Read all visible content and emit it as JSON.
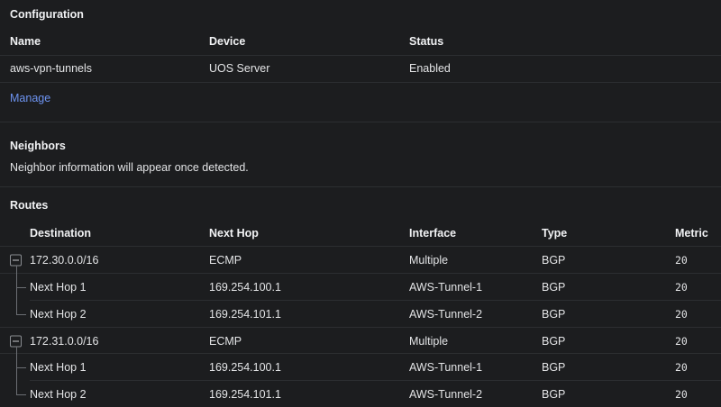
{
  "configuration": {
    "title": "Configuration",
    "headers": {
      "name": "Name",
      "device": "Device",
      "status": "Status"
    },
    "row": {
      "name": "aws-vpn-tunnels",
      "device": "UOS Server",
      "status": "Enabled"
    },
    "manage_link": "Manage"
  },
  "neighbors": {
    "title": "Neighbors",
    "message": "Neighbor information will appear once detected."
  },
  "routes": {
    "title": "Routes",
    "headers": {
      "destination": "Destination",
      "next_hop": "Next Hop",
      "interface": "Interface",
      "type": "Type",
      "metric": "Metric"
    },
    "groups": [
      {
        "destination": "172.30.0.0/16",
        "next_hop": "ECMP",
        "interface": "Multiple",
        "type": "BGP",
        "metric": "20",
        "children": [
          {
            "destination": "Next Hop 1",
            "next_hop": "169.254.100.1",
            "interface": "AWS-Tunnel-1",
            "type": "BGP",
            "metric": "20"
          },
          {
            "destination": "Next Hop 2",
            "next_hop": "169.254.101.1",
            "interface": "AWS-Tunnel-2",
            "type": "BGP",
            "metric": "20"
          }
        ]
      },
      {
        "destination": "172.31.0.0/16",
        "next_hop": "ECMP",
        "interface": "Multiple",
        "type": "BGP",
        "metric": "20",
        "children": [
          {
            "destination": "Next Hop 1",
            "next_hop": "169.254.100.1",
            "interface": "AWS-Tunnel-1",
            "type": "BGP",
            "metric": "20"
          },
          {
            "destination": "Next Hop 2",
            "next_hop": "169.254.101.1",
            "interface": "AWS-Tunnel-2",
            "type": "BGP",
            "metric": "20"
          }
        ]
      }
    ]
  },
  "colors": {
    "background": "#1c1d1f",
    "text": "#e3e4e6",
    "link": "#6d93f0",
    "divider": "#2c2e31"
  }
}
